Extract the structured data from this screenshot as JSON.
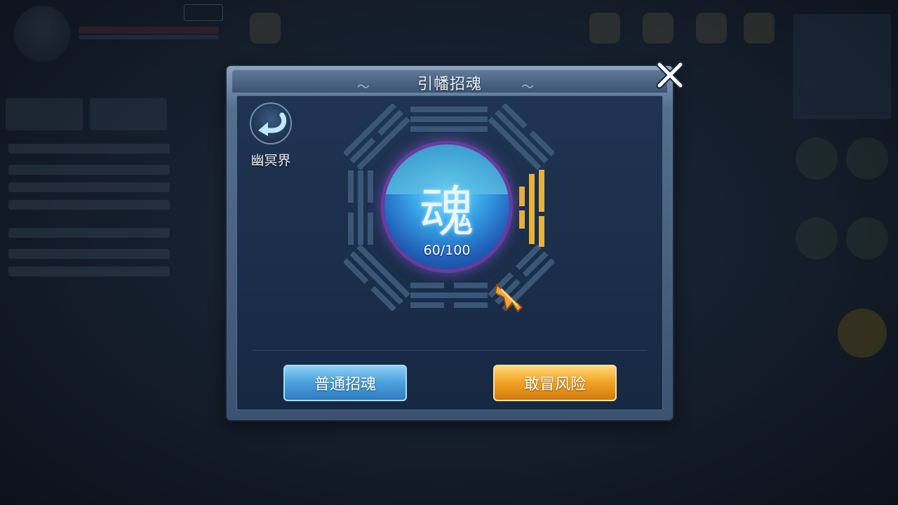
{
  "dialog": {
    "title": "引幡招魂",
    "back_label": "幽冥界",
    "orb_glyph": "魂",
    "progress_text": "60/100",
    "progress": {
      "current": 60,
      "max": 100
    },
    "buttons": {
      "normal_label": "普通招魂",
      "risk_label": "敢冒风险"
    }
  },
  "icons": [
    "close-icon",
    "back-arrow-icon",
    "bagua-icon",
    "soul-orb-icon",
    "pointer-arrow-icon"
  ],
  "colors": {
    "accent_blue": "#4fa5de",
    "accent_gold": "#f3a628",
    "trigram_active": "#e8b23a",
    "trigram_inactive": "#3b5778"
  }
}
